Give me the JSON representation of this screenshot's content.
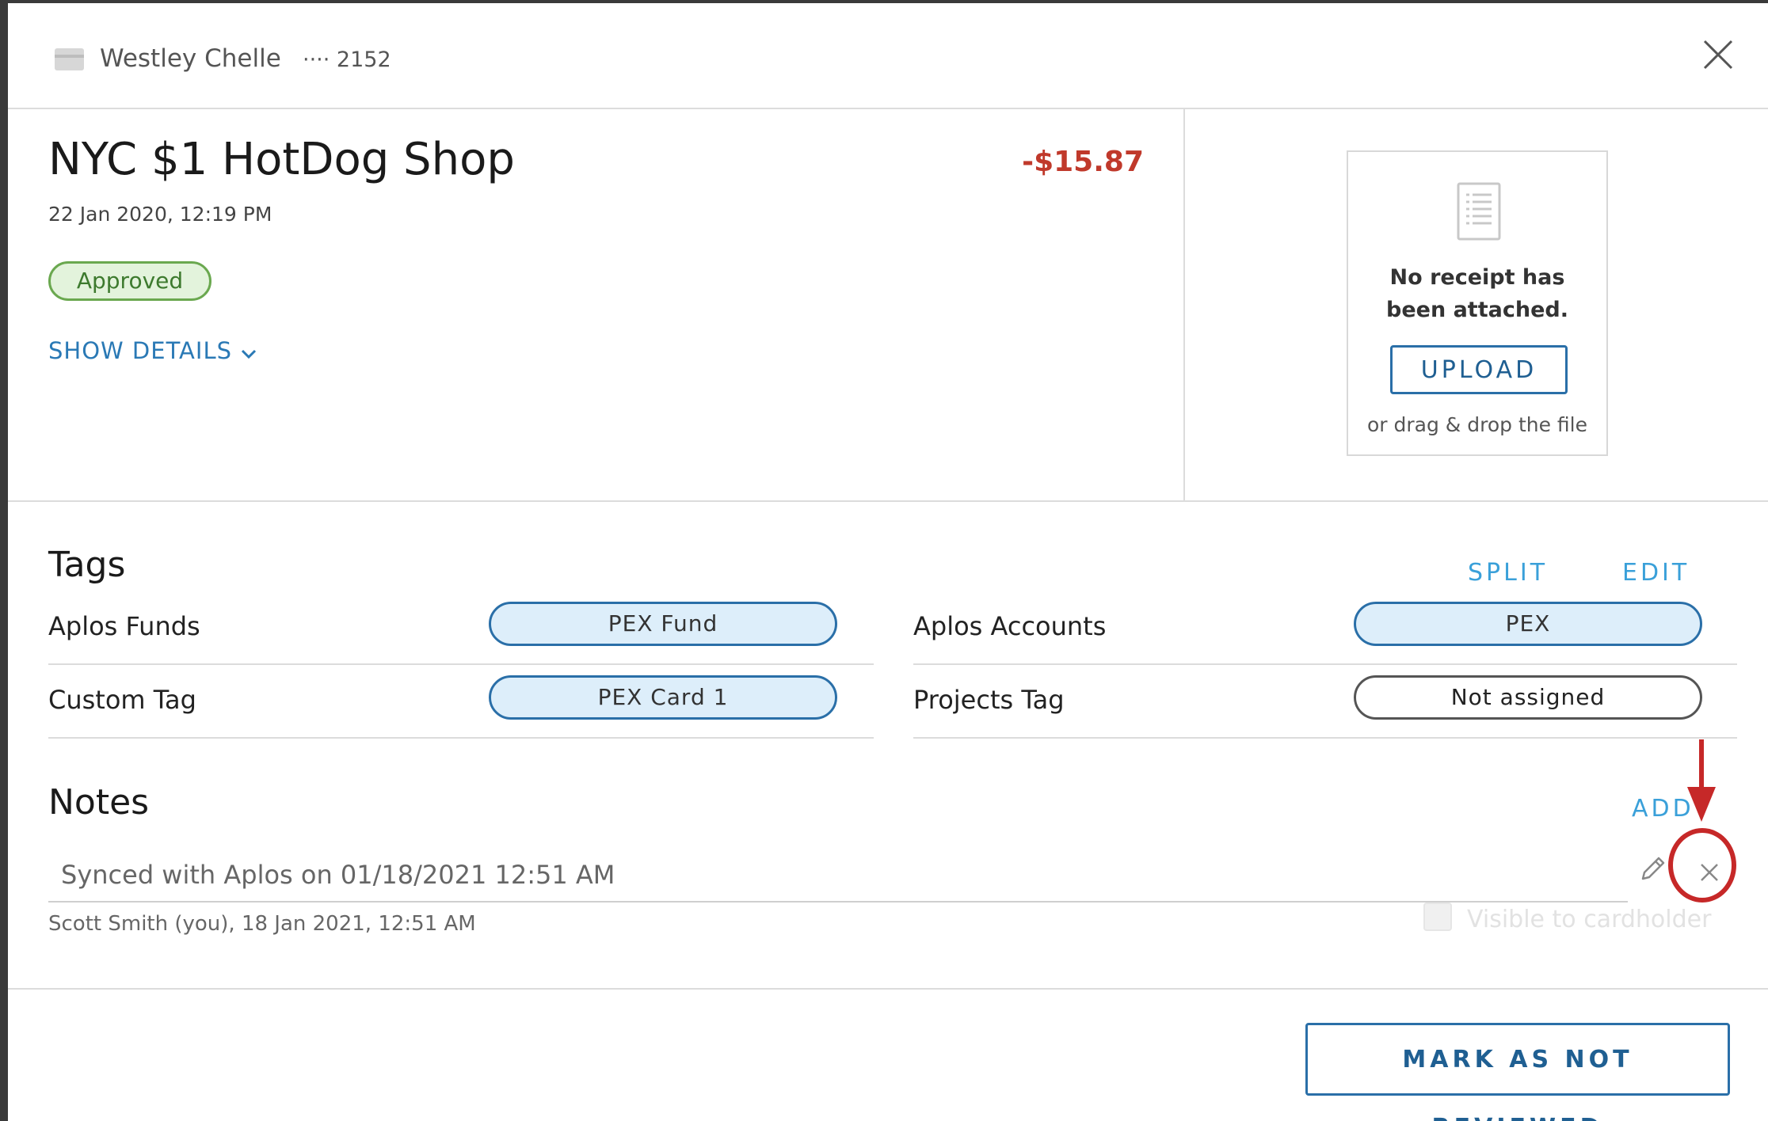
{
  "header": {
    "cardholder": "Westley Chelle",
    "card_number": "···· 2152",
    "close_icon": "close-icon"
  },
  "transaction": {
    "merchant": "NYC $1 HotDog Shop",
    "amount": "-$15.87",
    "amount_color": "#c0392b",
    "date": "22 Jan 2020, 12:19 PM",
    "status": "Approved",
    "show_details": "SHOW DETAILS"
  },
  "receipt": {
    "message": "No receipt has been attached.",
    "upload_label": "UPLOAD",
    "drag_text": "or drag & drop the file"
  },
  "tags": {
    "title": "Tags",
    "split_label": "SPLIT",
    "edit_label": "EDIT",
    "rows": [
      {
        "label": "Aplos Funds",
        "value": "PEX Fund"
      },
      {
        "label": "Aplos Accounts",
        "value": "PEX"
      },
      {
        "label": "Custom Tag",
        "value": "PEX Card 1"
      },
      {
        "label": "Projects Tag",
        "value": "Not assigned"
      }
    ]
  },
  "notes": {
    "title": "Notes",
    "add_label": "ADD",
    "items": [
      {
        "text": "Synced with Aplos on 01/18/2021 12:51 AM",
        "meta": "Scott Smith  (you), 18 Jan 2021, 12:51 AM"
      }
    ],
    "visible_label": "Visible to cardholder"
  },
  "footer": {
    "mark_label": "MARK AS NOT REVIEWED"
  },
  "colors": {
    "accent": "#2a6fa8",
    "link": "#3aa0d9",
    "approved": "#6aa84f",
    "annotation": "#c62828"
  }
}
